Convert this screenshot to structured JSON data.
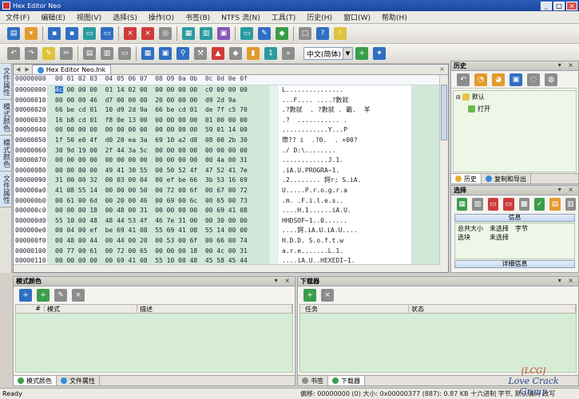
{
  "window": {
    "title": "Hex Editor Neo"
  },
  "menu": [
    "文件(F)",
    "编辑(E)",
    "视图(V)",
    "选择(S)",
    "操作(O)",
    "书签(B)",
    "NTFS 流(N)",
    "工具(T)",
    "历史(H)",
    "窗口(W)",
    "帮助(H)"
  ],
  "toolbar": {
    "encoding": "中文(简体)"
  },
  "left_tabs": [
    "文件属性",
    "模式颜色",
    "模式颜色",
    "文件属性"
  ],
  "document": {
    "tab_label": "Hex Editor Neo.lnk",
    "header_offset": "00000000",
    "header_bytes": "00 01 02 03  04 05 06 07  08 09 0a 0b  0c 0d 0e 0f",
    "rows": [
      {
        "off": "00000000",
        "bytes": "4c 00 00 00  01 14 02 00  00 00 00 00  c0 00 00 00",
        "ascii": "L..............."
      },
      {
        "off": "00000010",
        "bytes": "00 00 00 46  d7 00 00 00  20 00 00 00  d9 2d 9a",
        "ascii": "...F.... ....?數就"
      },
      {
        "off": "00000020",
        "bytes": "66 be cd 01  10 d9 2d 9a  66 be cd 01  de 7f c5 70",
        "ascii": ".?數就  . ?數就 . 霸.  羊"
      },
      {
        "off": "00000030",
        "bytes": "16 b8 cd 01  f8 0e 13 00  00 00 00 00  01 00 00 00",
        "ascii": ".?  ........... ."
      },
      {
        "off": "00000040",
        "bytes": "00 00 00 00  00 00 00 00  00 00 00 00  59 01 14 00",
        "ascii": "............Y...P"
      },
      {
        "off": "00000050",
        "bytes": "1f 50 e0 4f  d0 20 ea 3a  69 10 a2 d8  08 00 2b 30",
        "ascii": "帶?? i  .?0.  . +00?"
      },
      {
        "off": "00000060",
        "bytes": "30 9d 19 00  2f 44 3a 5c  00 00 00 00  00 00 00 00",
        "ascii": "./ D:\\........"
      },
      {
        "off": "00000070",
        "bytes": "00 00 00 00  00 00 00 00  00 00 00 00  00 4a 00 31",
        "ascii": "............J.1."
      },
      {
        "off": "00000080",
        "bytes": "00 00 00 00  49 41 30 55  00 50 52 4f  47 52 41 7e",
        "ascii": ".iA.U.PROGRA~1."
      },
      {
        "off": "00000090",
        "bytes": "31 00 00 32  00 03 00 04  00 ef be 66  3b 53 16 69",
        "ascii": ".2........ 鍔r; S.iA."
      },
      {
        "off": "000000a0",
        "bytes": "41 08 55 14  00 00 00 50  00 72 00 6f  00 67 00 72",
        "ascii": "U.....P.r.o.g.r.a"
      },
      {
        "off": "000000b0",
        "bytes": "00 61 00 6d  00 20 00 46  00 69 00 6c  00 65 00 73",
        "ascii": ".m. .F.i.l.e.s.."
      },
      {
        "off": "000000c0",
        "bytes": "00 00 00 18  00 48 00 31  00 00 00 00  00 69 41 08",
        "ascii": "....H.1......iA.U."
      },
      {
        "off": "000000d0",
        "bytes": "55 10 00 48  48 44 53 4f  46 7e 31 00  00 30 00 00",
        "ascii": "HHDSOF~1..0......"
      },
      {
        "off": "000000e0",
        "bytes": "00 04 00 ef  be 69 41 08  55 69 41 08  55 14 00 00",
        "ascii": "....鍔.iA.U.iA.U...."
      },
      {
        "off": "000000f0",
        "bytes": "00 48 00 44  00 44 00 20  00 53 00 6f  00 66 00 74",
        "ascii": "H.D.D. S.o.f.t.w"
      },
      {
        "off": "00000100",
        "bytes": "00 77 00 61  00 72 00 65  00 00 00 18  00 4c 00 31",
        "ascii": "a.r.e.......L.1."
      },
      {
        "off": "00000110",
        "bytes": "00 00 00 00  00 69 41 08  55 10 00 48  45 58 45 44",
        "ascii": "....iA.U..HEXEDI~1."
      },
      {
        "off": "00000120",
        "bytes": "49 7e 31 00  00 34 00 03  00 04 00 ef  be 69 41 08",
        "ascii": "4......鍔.iA."
      }
    ]
  },
  "history": {
    "title": "历史",
    "root": "默认",
    "child": "打开",
    "tabs": [
      "历史",
      "复制和导出"
    ]
  },
  "selection": {
    "title": "选择",
    "info_bar": "信息",
    "detail_bar": "详细信息",
    "rows": [
      {
        "k": "总共大小",
        "v1": "未选择",
        "v2": "字节"
      },
      {
        "k": "选块",
        "v1": "未选择",
        "v2": ""
      }
    ]
  },
  "mode_color": {
    "title": "模式颜色",
    "columns": [
      "#",
      "模式",
      "描述"
    ],
    "tabs": [
      "模式颜色",
      "文件属性"
    ]
  },
  "downloader": {
    "title": "下载器",
    "columns": [
      "任务",
      "状态"
    ],
    "tabs": [
      "书签",
      "下载器"
    ]
  },
  "status": {
    "left": "Ready",
    "right": "偏移: 00000000 (0)  大小: 0x00000377 (887): 0.87 KB  十六进制 字节, 默认编码 改写"
  },
  "watermark": {
    "tag": "[LCG]",
    "text": "Love Crack Group"
  }
}
